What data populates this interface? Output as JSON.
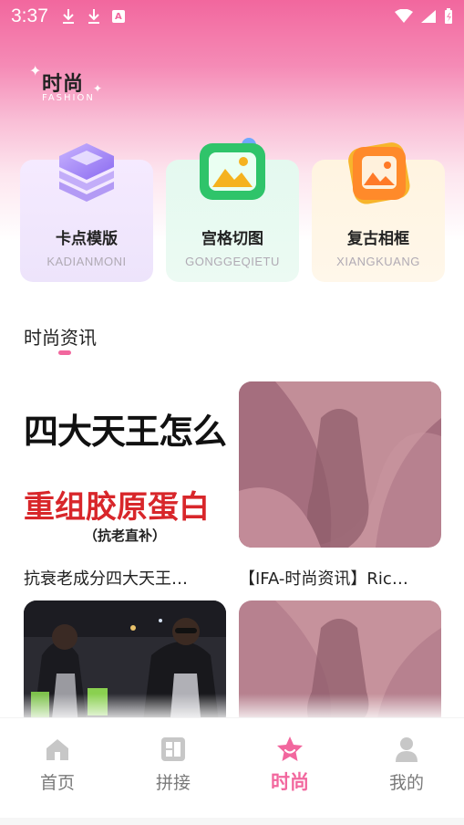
{
  "status": {
    "time": "3:37",
    "notif_letter": "A"
  },
  "brand": {
    "title": "时尚",
    "subtitle": "FASHION"
  },
  "features": [
    {
      "title": "卡点模版",
      "sub": "KADIANMONI",
      "icon": "stack-layers-icon"
    },
    {
      "title": "宫格切图",
      "sub": "GONGGEQIETU",
      "icon": "green-image-icon"
    },
    {
      "title": "复古相框",
      "sub": "XIANGKUANG",
      "icon": "orange-image-icon"
    }
  ],
  "section": {
    "title": "时尚资讯"
  },
  "news": [
    {
      "caption": "抗衰老成分四大天王…",
      "thumb_line1": "四大天王怎么",
      "thumb_line2": "重组胶原蛋白",
      "thumb_line3": "（抗老直补）"
    },
    {
      "caption": "【IFA-时尚资讯】Ric…"
    },
    {
      "caption": ""
    },
    {
      "caption": ""
    }
  ],
  "tabs": [
    {
      "label": "首页",
      "icon": "home-icon"
    },
    {
      "label": "拼接",
      "icon": "collage-icon"
    },
    {
      "label": "时尚",
      "icon": "star-icon",
      "active": true
    },
    {
      "label": "我的",
      "icon": "profile-icon"
    }
  ],
  "colors": {
    "accent": "#f2679e",
    "inactive": "#7a7a7a"
  }
}
